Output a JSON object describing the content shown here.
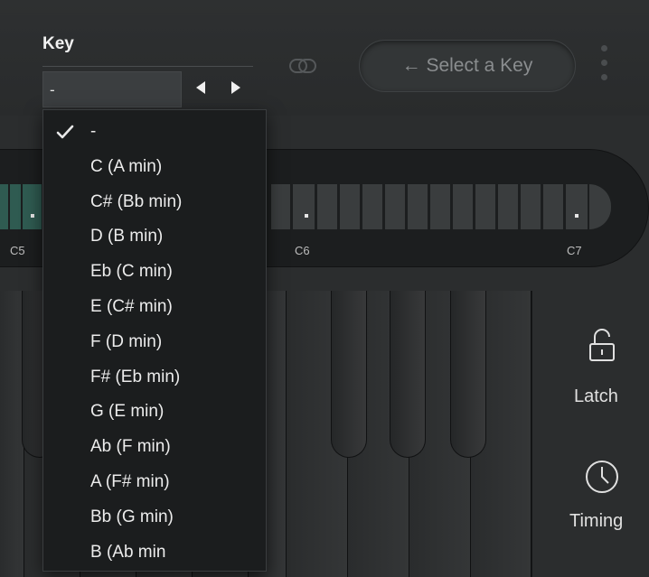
{
  "key_panel": {
    "title": "Key",
    "selected_value": "-",
    "select_key_button": "← Select a Key"
  },
  "piano_roll": {
    "octave_labels": [
      "C5",
      "C6",
      "C7"
    ]
  },
  "side_panel": {
    "latch_label": "Latch",
    "timing_label": "Timing"
  },
  "key_dropdown": {
    "options": [
      {
        "label": "-",
        "checked": true
      },
      {
        "label": "C (A min)",
        "checked": false
      },
      {
        "label": "C# (Bb min)",
        "checked": false
      },
      {
        "label": "D (B min)",
        "checked": false
      },
      {
        "label": "Eb (C min)",
        "checked": false
      },
      {
        "label": "E (C# min)",
        "checked": false
      },
      {
        "label": "F (D min)",
        "checked": false
      },
      {
        "label": "F# (Eb min)",
        "checked": false
      },
      {
        "label": "G (E min)",
        "checked": false
      },
      {
        "label": "Ab (F min)",
        "checked": false
      },
      {
        "label": "A (F# min)",
        "checked": false
      },
      {
        "label": "Bb (G min)",
        "checked": false
      },
      {
        "label": "B (Ab min",
        "checked": false
      }
    ]
  },
  "colors": {
    "accent_green": "#2f5b51",
    "background": "#1f2122",
    "menu_background": "#1b1d1e"
  }
}
